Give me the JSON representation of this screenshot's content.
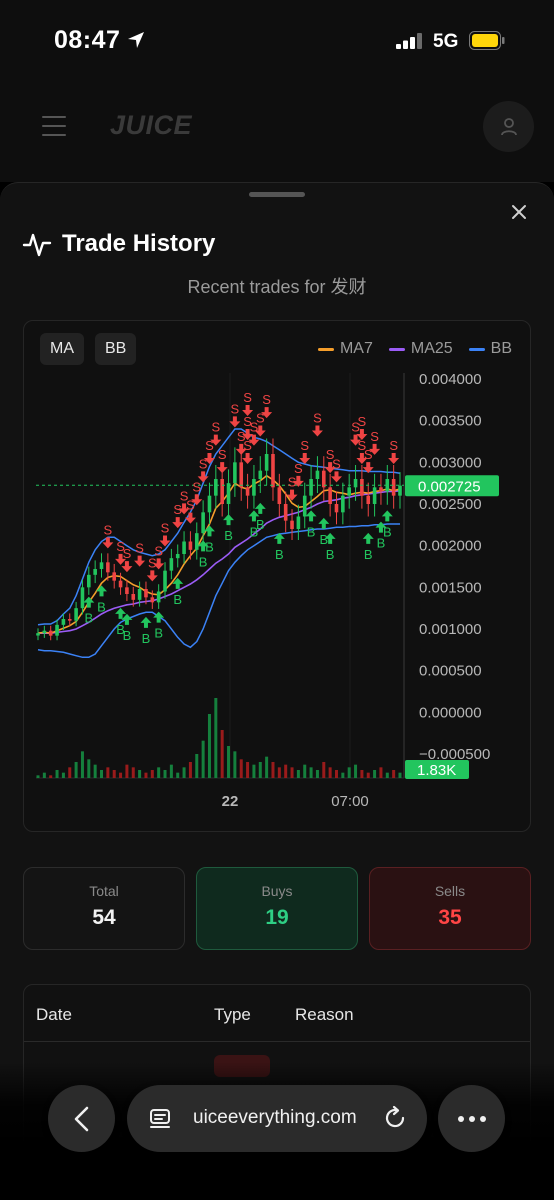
{
  "status_bar": {
    "time": "08:47",
    "network": "5G"
  },
  "app": {
    "brand": "JUICE"
  },
  "sheet": {
    "title": "Trade History",
    "subtitle": "Recent trades for 发财"
  },
  "chart": {
    "controls": {
      "ma_label": "MA",
      "bb_label": "BB"
    },
    "legend": [
      {
        "label": "MA7",
        "color": "#f59e2b"
      },
      {
        "label": "MA25",
        "color": "#9b5cf6"
      },
      {
        "label": "BB",
        "color": "#3b82f6"
      }
    ],
    "colors": {
      "up": "#22c55e",
      "down": "#ef4444",
      "buy_marker": "#22c55e",
      "sell_marker": "#ef4444"
    }
  },
  "chart_data": {
    "type": "line",
    "description_series": "candlestick price with MA7, MA25, Bollinger Bands and volume",
    "y_ticks": [
      "0.004000",
      "0.003500",
      "0.003000",
      "0.002500",
      "0.002000",
      "0.001500",
      "0.001000",
      "0.000500",
      "0.000000",
      "−0.000500"
    ],
    "ylim": [
      -0.0005,
      0.004
    ],
    "x_ticks": [
      "22",
      "07:00"
    ],
    "current_price_label": "0.002725",
    "current_price": 0.002725,
    "volume_label": "1.83K",
    "close": [
      0.00095,
      0.00098,
      0.00092,
      0.00105,
      0.00112,
      0.0011,
      0.00125,
      0.0015,
      0.00165,
      0.00172,
      0.0018,
      0.00168,
      0.00158,
      0.0015,
      0.00142,
      0.00135,
      0.00148,
      0.00138,
      0.00132,
      0.00145,
      0.0017,
      0.00185,
      0.0019,
      0.00205,
      0.00195,
      0.00215,
      0.0024,
      0.0026,
      0.0028,
      0.0025,
      0.00275,
      0.003,
      0.0027,
      0.0026,
      0.0028,
      0.0029,
      0.0031,
      0.0027,
      0.0025,
      0.0023,
      0.0022,
      0.00235,
      0.0026,
      0.0028,
      0.0029,
      0.0027,
      0.0025,
      0.0024,
      0.0026,
      0.0027,
      0.0028,
      0.0026,
      0.0025,
      0.0027,
      0.00265,
      0.0028,
      0.0026,
      0.00272
    ],
    "ma7": [
      0.00095,
      0.00096,
      0.00095,
      0.00098,
      0.00101,
      0.00104,
      0.00109,
      0.0012,
      0.00132,
      0.00143,
      0.00155,
      0.00162,
      0.00164,
      0.00163,
      0.00158,
      0.00153,
      0.0015,
      0.00145,
      0.00142,
      0.00141,
      0.00147,
      0.00155,
      0.00165,
      0.00178,
      0.00188,
      0.00197,
      0.00212,
      0.00226,
      0.00245,
      0.00253,
      0.00263,
      0.00275,
      0.0027,
      0.00268,
      0.00274,
      0.00278,
      0.00284,
      0.00279,
      0.00272,
      0.00262,
      0.00251,
      0.00246,
      0.00247,
      0.00253,
      0.00259,
      0.00266,
      0.00267,
      0.00264,
      0.00263,
      0.00261,
      0.00263,
      0.00264,
      0.00263,
      0.00265,
      0.00266,
      0.00268,
      0.00266,
      0.00268
    ],
    "ma25": [
      0.00095,
      0.00095,
      0.00095,
      0.00096,
      0.00097,
      0.00098,
      0.001,
      0.00104,
      0.00108,
      0.00113,
      0.00118,
      0.00122,
      0.00125,
      0.00127,
      0.00129,
      0.0013,
      0.00132,
      0.00133,
      0.00134,
      0.00136,
      0.00139,
      0.00142,
      0.00146,
      0.0015,
      0.00154,
      0.00159,
      0.00165,
      0.00172,
      0.00179,
      0.00184,
      0.0019,
      0.00198,
      0.00203,
      0.00208,
      0.00214,
      0.0022,
      0.00227,
      0.00231,
      0.00234,
      0.00236,
      0.00238,
      0.0024,
      0.00243,
      0.00246,
      0.0025,
      0.00253,
      0.00254,
      0.00255,
      0.00257,
      0.00258,
      0.0026,
      0.00261,
      0.00262,
      0.00263,
      0.00264,
      0.00265,
      0.00265,
      0.00266
    ],
    "bb_upper": [
      0.00105,
      0.00106,
      0.00106,
      0.0011,
      0.00118,
      0.00125,
      0.0014,
      0.0016,
      0.0018,
      0.00195,
      0.00205,
      0.0021,
      0.0021,
      0.00205,
      0.002,
      0.00195,
      0.00192,
      0.0019,
      0.00188,
      0.0019,
      0.00195,
      0.00205,
      0.00215,
      0.00228,
      0.0024,
      0.00255,
      0.00275,
      0.00295,
      0.0031,
      0.0032,
      0.0033,
      0.0034,
      0.0034,
      0.00335,
      0.0033,
      0.00328,
      0.00325,
      0.0032,
      0.00315,
      0.0031,
      0.00305,
      0.003,
      0.00298,
      0.00296,
      0.00295,
      0.00294,
      0.00293,
      0.00292,
      0.00291,
      0.0029,
      0.0029,
      0.0029,
      0.00289,
      0.00289,
      0.00289,
      0.00288,
      0.00288,
      0.00287
    ],
    "bb_lower": [
      0.00075,
      0.00074,
      0.00074,
      0.00073,
      0.00072,
      0.0007,
      0.00068,
      0.00066,
      0.00066,
      0.0007,
      0.0008,
      0.0009,
      0.001,
      0.00108,
      0.00112,
      0.00115,
      0.00118,
      0.0012,
      0.0012,
      0.00115,
      0.0011,
      0.001,
      0.0009,
      0.00082,
      0.00078,
      0.00085,
      0.001,
      0.0012,
      0.0014,
      0.00155,
      0.0017,
      0.0018,
      0.00188,
      0.00195,
      0.002,
      0.00205,
      0.0021,
      0.00212,
      0.00214,
      0.00215,
      0.00216,
      0.00217,
      0.00218,
      0.00219,
      0.0022,
      0.0022,
      0.00221,
      0.00222,
      0.00222,
      0.00223,
      0.00223,
      0.00224,
      0.00224,
      0.00225,
      0.00225,
      0.00226,
      0.00226,
      0.00226
    ],
    "volume": [
      1,
      2,
      1,
      3,
      2,
      4,
      6,
      10,
      7,
      5,
      3,
      4,
      3,
      2,
      5,
      4,
      3,
      2,
      3,
      4,
      3,
      5,
      2,
      4,
      6,
      9,
      14,
      24,
      30,
      18,
      12,
      10,
      7,
      6,
      5,
      6,
      8,
      6,
      4,
      5,
      4,
      3,
      5,
      4,
      3,
      6,
      4,
      3,
      2,
      4,
      5,
      3,
      2,
      3,
      4,
      2,
      3,
      2
    ],
    "buys": [
      [
        8,
        "B"
      ],
      [
        10,
        "B"
      ],
      [
        13,
        "B"
      ],
      [
        14,
        "B"
      ],
      [
        17,
        "B"
      ],
      [
        19,
        "B"
      ],
      [
        22,
        "B"
      ],
      [
        26,
        "B"
      ],
      [
        27,
        "B"
      ],
      [
        30,
        "B"
      ],
      [
        34,
        "B"
      ],
      [
        35,
        "B"
      ],
      [
        38,
        "B"
      ],
      [
        43,
        "B"
      ],
      [
        45,
        "B"
      ],
      [
        46,
        "B"
      ],
      [
        52,
        "B"
      ],
      [
        54,
        "B"
      ],
      [
        55,
        "B"
      ]
    ],
    "sells": [
      [
        11,
        "S"
      ],
      [
        13,
        "S"
      ],
      [
        14,
        "S"
      ],
      [
        16,
        "S"
      ],
      [
        18,
        "S"
      ],
      [
        19,
        "S"
      ],
      [
        20,
        "S"
      ],
      [
        22,
        "S"
      ],
      [
        23,
        "S"
      ],
      [
        24,
        "S"
      ],
      [
        25,
        "S"
      ],
      [
        26,
        "S"
      ],
      [
        27,
        "S"
      ],
      [
        28,
        "S"
      ],
      [
        29,
        "S"
      ],
      [
        31,
        "S"
      ],
      [
        32,
        "S"
      ],
      [
        33,
        "S"
      ],
      [
        33,
        "S"
      ],
      [
        33,
        "S"
      ],
      [
        34,
        "S"
      ],
      [
        35,
        "S"
      ],
      [
        36,
        "S"
      ],
      [
        40,
        "S"
      ],
      [
        41,
        "S"
      ],
      [
        42,
        "S"
      ],
      [
        44,
        "S"
      ],
      [
        46,
        "S"
      ],
      [
        47,
        "S"
      ],
      [
        50,
        "S"
      ],
      [
        51,
        "S"
      ],
      [
        51,
        "S"
      ],
      [
        52,
        "S"
      ],
      [
        53,
        "S"
      ],
      [
        56,
        "S"
      ]
    ]
  },
  "stats": {
    "total_label": "Total",
    "total_value": "54",
    "buys_label": "Buys",
    "buys_value": "19",
    "sells_label": "Sells",
    "sells_value": "35"
  },
  "table": {
    "headers": {
      "date": "Date",
      "type": "Type",
      "reason": "Reason"
    }
  },
  "browser": {
    "url": "uiceeverything.com"
  }
}
